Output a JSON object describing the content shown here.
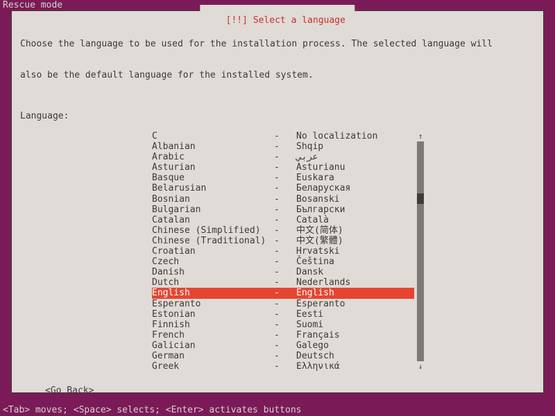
{
  "mode_label": "Rescue mode",
  "dialog": {
    "title_prefix": "[!!] ",
    "title": "Select a language",
    "description_line1": "Choose the language to be used for the installation process. The selected language will",
    "description_line2": "also be the default language for the installed system.",
    "field_label": "Language:",
    "go_back": "<Go Back>"
  },
  "languages": [
    {
      "name": "C",
      "native": "No localization",
      "selected": false
    },
    {
      "name": "Albanian",
      "native": "Shqip",
      "selected": false
    },
    {
      "name": "Arabic",
      "native": "عربي",
      "selected": false
    },
    {
      "name": "Asturian",
      "native": "Asturianu",
      "selected": false
    },
    {
      "name": "Basque",
      "native": "Euskara",
      "selected": false
    },
    {
      "name": "Belarusian",
      "native": "Беларуская",
      "selected": false
    },
    {
      "name": "Bosnian",
      "native": "Bosanski",
      "selected": false
    },
    {
      "name": "Bulgarian",
      "native": "Български",
      "selected": false
    },
    {
      "name": "Catalan",
      "native": "Català",
      "selected": false
    },
    {
      "name": "Chinese (Simplified)",
      "native": "中文(简体)",
      "selected": false
    },
    {
      "name": "Chinese (Traditional)",
      "native": "中文(繁體)",
      "selected": false
    },
    {
      "name": "Croatian",
      "native": "Hrvatski",
      "selected": false
    },
    {
      "name": "Czech",
      "native": "Čeština",
      "selected": false
    },
    {
      "name": "Danish",
      "native": "Dansk",
      "selected": false
    },
    {
      "name": "Dutch",
      "native": "Nederlands",
      "selected": false
    },
    {
      "name": "English",
      "native": "English",
      "selected": true
    },
    {
      "name": "Esperanto",
      "native": "Esperanto",
      "selected": false
    },
    {
      "name": "Estonian",
      "native": "Eesti",
      "selected": false
    },
    {
      "name": "Finnish",
      "native": "Suomi",
      "selected": false
    },
    {
      "name": "French",
      "native": "Français",
      "selected": false
    },
    {
      "name": "Galician",
      "native": "Galego",
      "selected": false
    },
    {
      "name": "German",
      "native": "Deutsch",
      "selected": false
    },
    {
      "name": "Greek",
      "native": "Ελληνικά",
      "selected": false
    }
  ],
  "separator": "-",
  "scroll": {
    "up": "↑",
    "down": "↓"
  },
  "footer": "<Tab> moves; <Space> selects; <Enter> activates buttons"
}
